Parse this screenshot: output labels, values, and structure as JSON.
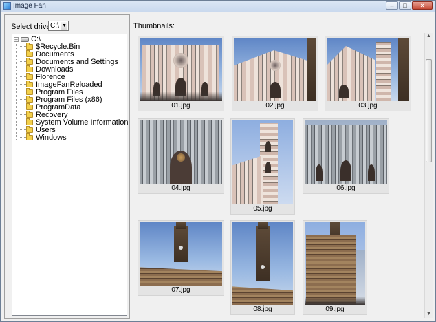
{
  "window": {
    "title": "Image Fan",
    "controls": [
      "minimize",
      "maximize",
      "close"
    ]
  },
  "left_panel": {
    "drive_label": "Select drive:",
    "drive_value": "C:\\",
    "tree": {
      "root": "C:\\",
      "items": [
        "$Recycle.Bin",
        "Documents",
        "Documents and Settings",
        "Downloads",
        "Florence",
        "ImageFanReloaded",
        "Program Files",
        "Program Files (x86)",
        "ProgramData",
        "Recovery",
        "System Volume Information",
        "Users",
        "Windows"
      ]
    }
  },
  "right_panel": {
    "label": "Thumbnails:",
    "thumbnails": [
      {
        "caption": "01.jpg",
        "subject": "duomo-facade"
      },
      {
        "caption": "02.jpg",
        "subject": "duomo-facade-angle"
      },
      {
        "caption": "03.jpg",
        "subject": "duomo-campanile"
      },
      {
        "caption": "04.jpg",
        "subject": "duomo-portal"
      },
      {
        "caption": "05.jpg",
        "subject": "campanile-tower"
      },
      {
        "caption": "06.jpg",
        "subject": "duomo-side"
      },
      {
        "caption": "07.jpg",
        "subject": "palazzo-vecchio-tower"
      },
      {
        "caption": "08.jpg",
        "subject": "palazzo-vecchio-tower"
      },
      {
        "caption": "09.jpg",
        "subject": "palazzo-vecchio-front"
      }
    ]
  },
  "colors": {
    "title_bar": "#c9d9ee",
    "close_button": "#c54a35",
    "folder": "#f3d04a",
    "panel_bg": "#f0f0f0"
  }
}
